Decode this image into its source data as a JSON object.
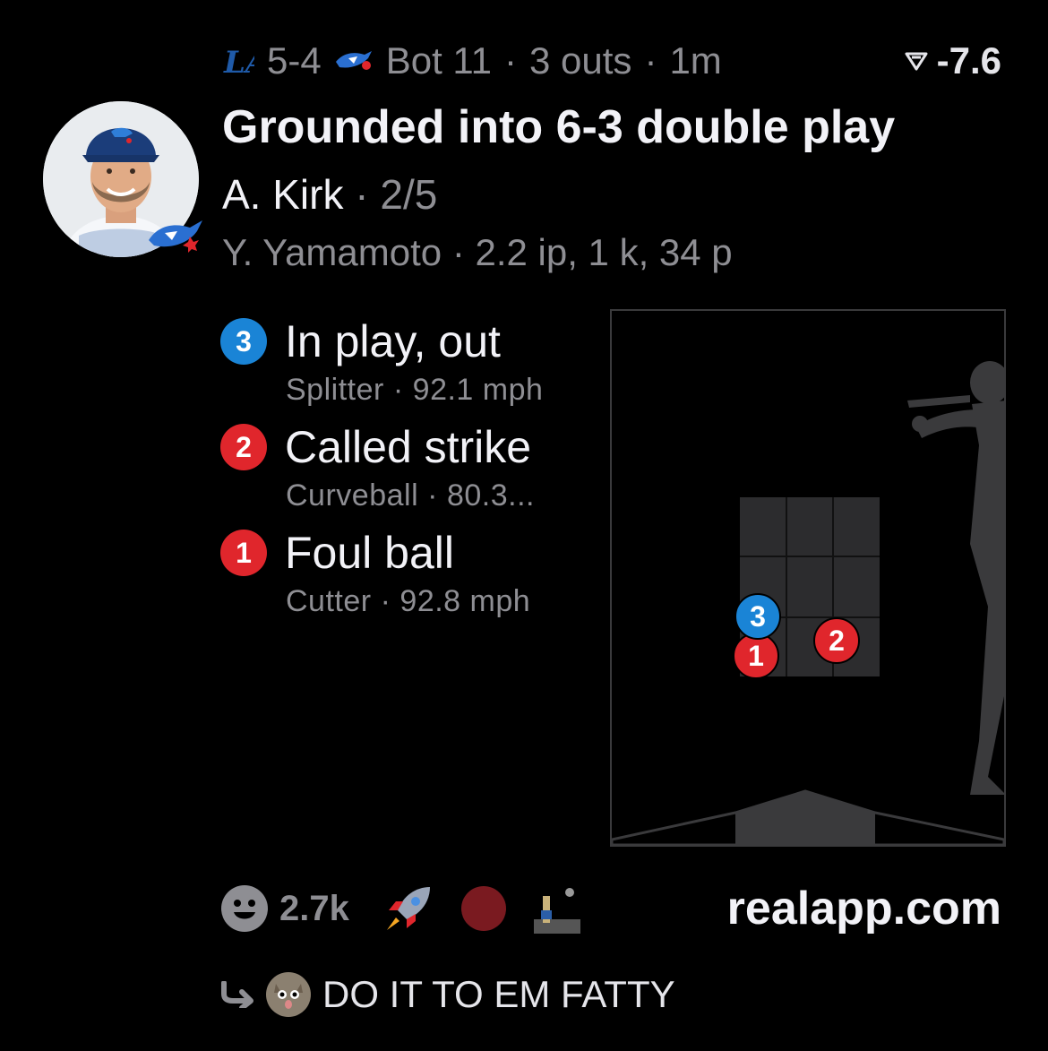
{
  "score": {
    "away_team_icon": "dodgers-la-logo",
    "score_text": "5-4",
    "home_team_icon": "blue-jays-logo",
    "inning": "Bot 11",
    "outs": "3 outs",
    "age": "1m",
    "sep": "·",
    "win_prob_icon": "win-probability-icon",
    "win_prob": "-7.6"
  },
  "play": {
    "title": "Grounded into 6-3 double play",
    "batter_name": "A. Kirk",
    "batter_stats": "2/5",
    "pitcher_line": "Y. Yamamoto · 2.2 ip, 1 k, 34 p"
  },
  "pitches": [
    {
      "num": "3",
      "result": "In play, out",
      "type": "Splitter",
      "speed": "92.1 mph",
      "color": "#1a84d6"
    },
    {
      "num": "2",
      "result": "Called strike",
      "type": "Curveball",
      "speed": "80.3...",
      "color": "#e0262c"
    },
    {
      "num": "1",
      "result": "Foul ball",
      "type": "Cutter",
      "speed": "92.8 mph",
      "color": "#e0262c"
    }
  ],
  "footer": {
    "reaction_icon": "smiley-face-icon",
    "reaction_count": "2.7k",
    "emojis": [
      "rocket-emoji",
      "red-circle-emoji",
      "astronaut-moon-emoji"
    ],
    "site": "realapp.com"
  },
  "reply": {
    "icon": "reply-arrow-icon",
    "avatar_icon": "cat-avatar",
    "text": "DO IT TO EM FATTY"
  },
  "colors": {
    "background": "#000000",
    "muted": "#8e8e93",
    "ball_in_play": "#1a84d6",
    "strike": "#e0262c",
    "zone": "#2c2c2e"
  }
}
